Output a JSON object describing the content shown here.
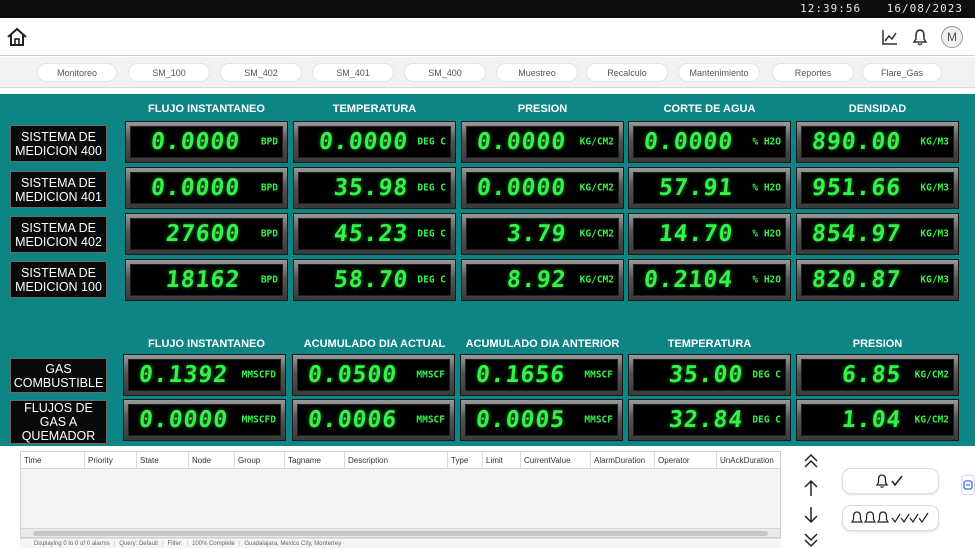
{
  "topbar": {
    "time": "12:39:56",
    "date": "16/08/2023"
  },
  "header": {
    "avatar_initial": "M"
  },
  "nav": {
    "tabs": [
      "Monitoreo",
      "SM_100",
      "SM_402",
      "SM_401",
      "SM_400",
      "Muestreo",
      "Recalculo",
      "Mantenimiento",
      "Reportes",
      "Flare_Gas"
    ]
  },
  "meters": {
    "headers": [
      "FLUJO INSTANTANEO",
      "TEMPERATURA",
      "PRESION",
      "CORTE DE AGUA",
      "DENSIDAD"
    ],
    "units": [
      "BPD",
      "DEG C",
      "KG/CM2",
      "% H2O",
      "KG/M3"
    ],
    "rows": [
      {
        "label_l1": "SISTEMA DE",
        "label_l2": "MEDICION 400",
        "values": [
          "0.0000",
          "0.0000",
          "0.0000",
          "0.0000",
          "890.00"
        ]
      },
      {
        "label_l1": "SISTEMA DE",
        "label_l2": "MEDICION 401",
        "values": [
          "0.0000",
          "35.98",
          "0.0000",
          "57.91",
          "951.66"
        ]
      },
      {
        "label_l1": "SISTEMA DE",
        "label_l2": "MEDICION 402",
        "values": [
          "27600",
          "45.23",
          "3.79",
          "14.70",
          "854.97"
        ]
      },
      {
        "label_l1": "SISTEMA DE",
        "label_l2": "MEDICION 100",
        "values": [
          "18162",
          "58.70",
          "8.92",
          "0.2104",
          "820.87"
        ]
      }
    ]
  },
  "gas": {
    "headers": [
      "FLUJO INSTANTANEO",
      "ACUMULADO DIA ACTUAL",
      "ACUMULADO DIA ANTERIOR",
      "TEMPERATURA",
      "PRESION"
    ],
    "units": [
      "MMSCFD",
      "MMSCF",
      "MMSCF",
      "DEG C",
      "KG/CM2"
    ],
    "rows": [
      {
        "label": [
          "GAS",
          "COMBUSTIBLE"
        ],
        "values": [
          "0.1392",
          "0.0500",
          "0.1656",
          "35.00",
          "6.85"
        ]
      },
      {
        "label": [
          "FLUJOS DE",
          "GAS A",
          "QUEMADOR"
        ],
        "values": [
          "0.0000",
          "0.0006",
          "0.0005",
          "32.84",
          "1.04"
        ]
      }
    ]
  },
  "alarms": {
    "columns": [
      "Time",
      "Priority",
      "State",
      "Node",
      "Group",
      "Tagname",
      "Description",
      "Type",
      "Limit",
      "CurrentValue",
      "AlarmDuration",
      "Operator",
      "UnAckDuration"
    ],
    "status": [
      "Displaying 0 to 0 of 0 alarms",
      "Query: Default",
      "Filter:",
      "100% Complete",
      "Guadalajara, Mexico City, Monterrey"
    ]
  },
  "colors": {
    "panel": "#0e8585",
    "digit": "#35f24a",
    "label_bg": "#0a0a0a"
  },
  "icons": [
    "home-icon",
    "trend-chart-icon",
    "bell-icon",
    "arrow-up-double-icon",
    "arrow-up-icon",
    "arrow-down-icon",
    "arrow-down-double-icon",
    "ack-single-icon",
    "ack-all-icon"
  ]
}
